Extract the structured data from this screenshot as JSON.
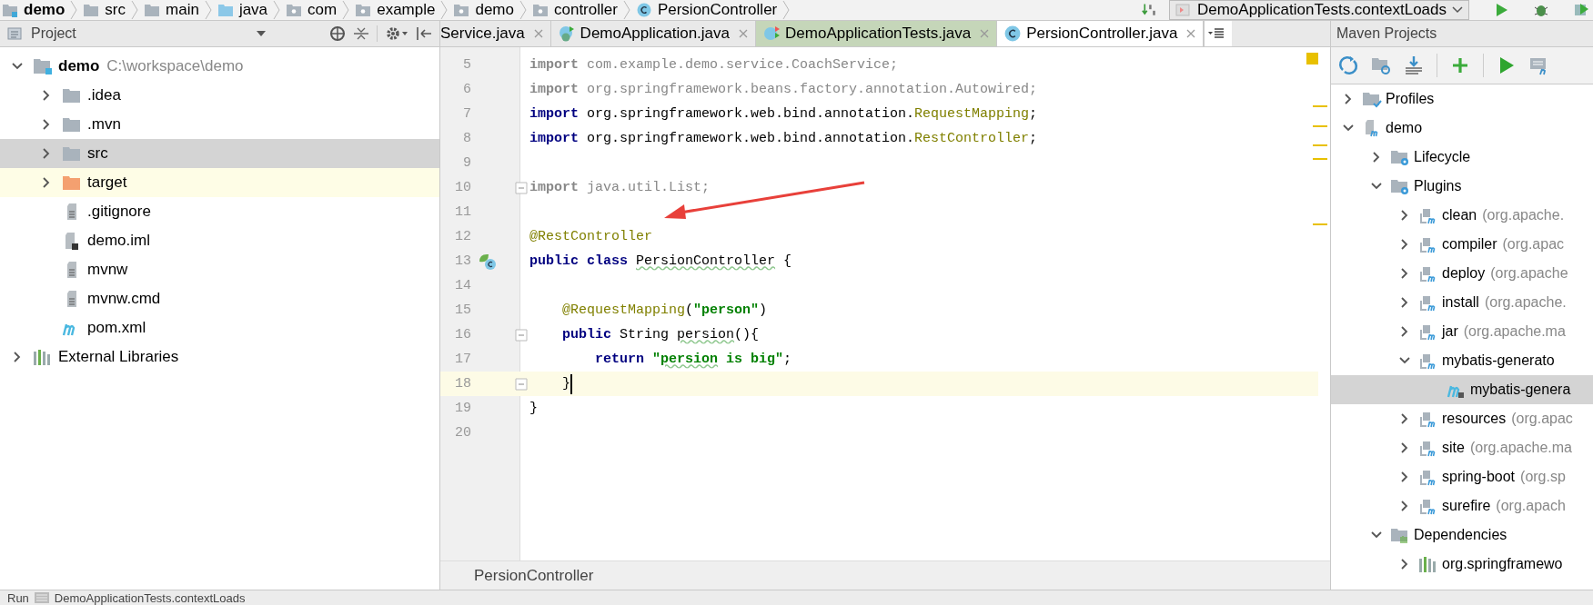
{
  "breadcrumbs": [
    {
      "label": "demo",
      "kind": "module"
    },
    {
      "label": "src",
      "kind": "folder"
    },
    {
      "label": "main",
      "kind": "folder"
    },
    {
      "label": "java",
      "kind": "source"
    },
    {
      "label": "com",
      "kind": "package"
    },
    {
      "label": "example",
      "kind": "package"
    },
    {
      "label": "demo",
      "kind": "package"
    },
    {
      "label": "controller",
      "kind": "package"
    },
    {
      "label": "PersionController",
      "kind": "class"
    }
  ],
  "toolbar": {
    "run_config": "DemoApplicationTests.contextLoads"
  },
  "project_panel": {
    "title": "Project",
    "tree": [
      {
        "label": "demo",
        "detail": "C:\\workspace\\demo",
        "kind": "module",
        "expandable": true,
        "expanded": true,
        "selected": false,
        "children": [
          {
            "label": ".idea",
            "kind": "folder",
            "expandable": true,
            "expanded": false,
            "selected": false
          },
          {
            "label": ".mvn",
            "kind": "folder",
            "expandable": true,
            "expanded": false,
            "selected": false
          },
          {
            "label": "src",
            "kind": "folder",
            "expandable": true,
            "expanded": false,
            "selected": true
          },
          {
            "label": "target",
            "kind": "excluded",
            "expandable": true,
            "expanded": false,
            "selected": false
          },
          {
            "label": ".gitignore",
            "kind": "text",
            "expandable": false,
            "expanded": false,
            "selected": false
          },
          {
            "label": "demo.iml",
            "kind": "iml",
            "expandable": false,
            "expanded": false,
            "selected": false
          },
          {
            "label": "mvnw",
            "kind": "text",
            "expandable": false,
            "expanded": false,
            "selected": false
          },
          {
            "label": "mvnw.cmd",
            "kind": "text",
            "expandable": false,
            "expanded": false,
            "selected": false
          },
          {
            "label": "pom.xml",
            "kind": "pom",
            "expandable": false,
            "expanded": false,
            "selected": false
          }
        ]
      },
      {
        "label": "External Libraries",
        "kind": "libraries",
        "expandable": true,
        "expanded": false,
        "selected": false
      }
    ]
  },
  "editor_tabs": [
    {
      "label": "Service.java",
      "kind": "partial",
      "selected": false
    },
    {
      "label": "DemoApplication.java",
      "kind": "app",
      "selected": false
    },
    {
      "label": "DemoApplicationTests.java",
      "kind": "test",
      "selected": false
    },
    {
      "label": "PersionController.java",
      "kind": "class",
      "selected": true
    }
  ],
  "editor": {
    "lines": [
      {
        "number": "5",
        "current": false,
        "fold": false,
        "class_marker": false,
        "tokens": [
          {
            "text": "import",
            "kind": "kw-unused"
          },
          {
            "text": " com.example.demo.service.CoachService;",
            "kind": "unused"
          }
        ]
      },
      {
        "number": "6",
        "current": false,
        "fold": false,
        "class_marker": false,
        "tokens": [
          {
            "text": "import",
            "kind": "kw-unused"
          },
          {
            "text": " org.springframework.beans.factory.annotation.Autowired;",
            "kind": "unused"
          }
        ]
      },
      {
        "number": "7",
        "current": false,
        "fold": false,
        "class_marker": false,
        "tokens": [
          {
            "text": "import",
            "kind": "kw"
          },
          {
            "text": " org.springframework.web.bind.annotation.",
            "kind": "plain"
          },
          {
            "text": "RequestMapping",
            "kind": "ann"
          },
          {
            "text": ";",
            "kind": "plain"
          }
        ]
      },
      {
        "number": "8",
        "current": false,
        "fold": false,
        "class_marker": false,
        "tokens": [
          {
            "text": "import",
            "kind": "kw"
          },
          {
            "text": " org.springframework.web.bind.annotation.",
            "kind": "plain"
          },
          {
            "text": "RestController",
            "kind": "ann"
          },
          {
            "text": ";",
            "kind": "plain"
          }
        ]
      },
      {
        "number": "9",
        "current": false,
        "fold": false,
        "class_marker": false
      },
      {
        "number": "10",
        "current": false,
        "fold": true,
        "class_marker": false,
        "tokens": [
          {
            "text": "import",
            "kind": "kw-unused"
          },
          {
            "text": " java.util.List;",
            "kind": "unused"
          }
        ]
      },
      {
        "number": "11",
        "current": false,
        "fold": false,
        "class_marker": false
      },
      {
        "number": "12",
        "current": false,
        "fold": false,
        "class_marker": false,
        "tokens": [
          {
            "text": "@RestController",
            "kind": "ann"
          }
        ]
      },
      {
        "number": "13",
        "current": false,
        "fold": false,
        "class_marker": true,
        "tokens": [
          {
            "text": "public class ",
            "kind": "kw"
          },
          {
            "text": "PersionController",
            "kind": "typo"
          },
          {
            "text": " {",
            "kind": "plain"
          }
        ]
      },
      {
        "number": "14",
        "current": false,
        "fold": false,
        "class_marker": false
      },
      {
        "number": "15",
        "current": false,
        "fold": false,
        "class_marker": false,
        "tokens": [
          {
            "text": "    @RequestMapping",
            "kind": "ann"
          },
          {
            "text": "(",
            "kind": "plain"
          },
          {
            "text": "\"person\"",
            "kind": "str"
          },
          {
            "text": ")",
            "kind": "plain"
          }
        ]
      },
      {
        "number": "16",
        "current": false,
        "fold": true,
        "class_marker": false,
        "tokens": [
          {
            "text": "    public",
            "kind": "kw"
          },
          {
            "text": " String ",
            "kind": "plain"
          },
          {
            "text": "persion",
            "kind": "typo"
          },
          {
            "text": "(){",
            "kind": "plain"
          }
        ]
      },
      {
        "number": "17",
        "current": false,
        "fold": false,
        "class_marker": false,
        "tokens": [
          {
            "text": "        return ",
            "kind": "kw"
          },
          {
            "text": "\"",
            "kind": "str"
          },
          {
            "text": "persion",
            "kind": "str-typo"
          },
          {
            "text": " is big\"",
            "kind": "str"
          },
          {
            "text": ";",
            "kind": "plain"
          }
        ]
      },
      {
        "number": "18",
        "current": true,
        "fold": true,
        "class_marker": false,
        "tokens": [
          {
            "text": "    }",
            "kind": "plain"
          }
        ]
      },
      {
        "number": "19",
        "current": false,
        "fold": false,
        "class_marker": false,
        "tokens": [
          {
            "text": "}",
            "kind": "plain"
          }
        ]
      },
      {
        "number": "20",
        "current": false,
        "fold": false,
        "class_marker": false
      }
    ],
    "breadcrumb": "PersionController"
  },
  "maven_panel": {
    "title": "Maven Projects",
    "tree": [
      {
        "label": "Profiles",
        "kind": "profiles",
        "expandable": true,
        "expanded": false,
        "selected": false
      },
      {
        "label": "demo",
        "kind": "project",
        "expandable": true,
        "expanded": true,
        "selected": false,
        "children": [
          {
            "label": "Lifecycle",
            "kind": "lifecycle",
            "expandable": true,
            "expanded": false,
            "selected": false
          },
          {
            "label": "Plugins",
            "kind": "lifecycle",
            "expandable": true,
            "expanded": true,
            "selected": false,
            "children": [
              {
                "label": "clean",
                "detail": "(org.apache.",
                "kind": "plugin",
                "expandable": true,
                "expanded": false,
                "selected": false
              },
              {
                "label": "compiler",
                "detail": "(org.apac",
                "kind": "plugin",
                "expandable": true,
                "expanded": false,
                "selected": false
              },
              {
                "label": "deploy",
                "detail": "(org.apache",
                "kind": "plugin",
                "expandable": true,
                "expanded": false,
                "selected": false
              },
              {
                "label": "install",
                "detail": "(org.apache.",
                "kind": "plugin",
                "expandable": true,
                "expanded": false,
                "selected": false
              },
              {
                "label": "jar",
                "detail": "(org.apache.ma",
                "kind": "plugin",
                "expandable": true,
                "expanded": false,
                "selected": false
              },
              {
                "label": "mybatis-generato",
                "kind": "plugin",
                "expandable": true,
                "expanded": true,
                "selected": false,
                "children": [
                  {
                    "label": "mybatis-genera",
                    "kind": "goal",
                    "expandable": false,
                    "expanded": false,
                    "selected": true
                  }
                ]
              },
              {
                "label": "resources",
                "detail": "(org.apac",
                "kind": "plugin",
                "expandable": true,
                "expanded": false,
                "selected": false
              },
              {
                "label": "site",
                "detail": "(org.apache.ma",
                "kind": "plugin",
                "expandable": true,
                "expanded": false,
                "selected": false
              },
              {
                "label": "spring-boot",
                "detail": "(org.sp",
                "kind": "plugin",
                "expandable": true,
                "expanded": false,
                "selected": false
              },
              {
                "label": "surefire",
                "detail": "(org.apach",
                "kind": "plugin",
                "expandable": true,
                "expanded": false,
                "selected": false
              }
            ]
          },
          {
            "label": "Dependencies",
            "kind": "dependencies",
            "expandable": true,
            "expanded": true,
            "selected": false,
            "children": [
              {
                "label": "org.springframewo",
                "kind": "library",
                "expandable": true,
                "expanded": false,
                "selected": false
              }
            ]
          }
        ]
      }
    ]
  },
  "status_bar": {
    "label": "Run",
    "text": "DemoApplicationTests.contextLoads"
  }
}
